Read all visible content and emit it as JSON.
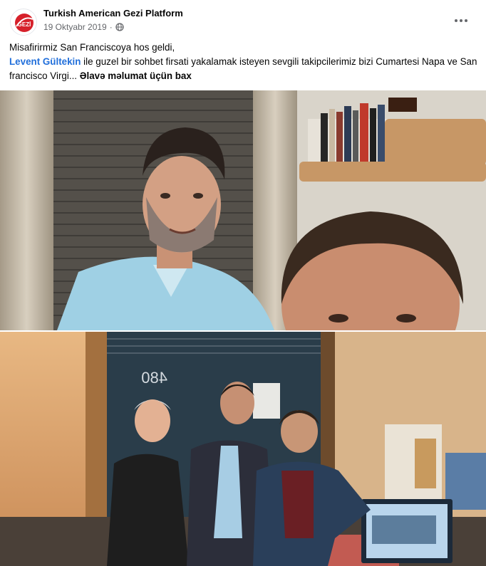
{
  "post": {
    "page_name": "Turkish American Gezi Platform",
    "timestamp": "19 Oktyabr 2019",
    "separator": "·",
    "privacy_icon": "globe-icon",
    "more_icon": "more-options-icon",
    "avatar": {
      "logo_text": "GEZİ",
      "logo_color": "#d6202a"
    },
    "text": {
      "line1": "Misafirirmiz San Franciscoya hos geldi,",
      "mention": "Levent Gültekin",
      "line2_rest": " ile guzel bir sohbet firsati yakalamak isteyen sevgili takipcilerimiz bizi Cumartesi Napa ve San francisco Virgi",
      "ellipsis": "...",
      "see_more": " Əlavə məlumat üçün bax"
    },
    "photos": [
      {
        "name": "selfie-photo",
        "room_number": ""
      },
      {
        "name": "group-photo",
        "door_number": "480"
      }
    ]
  }
}
